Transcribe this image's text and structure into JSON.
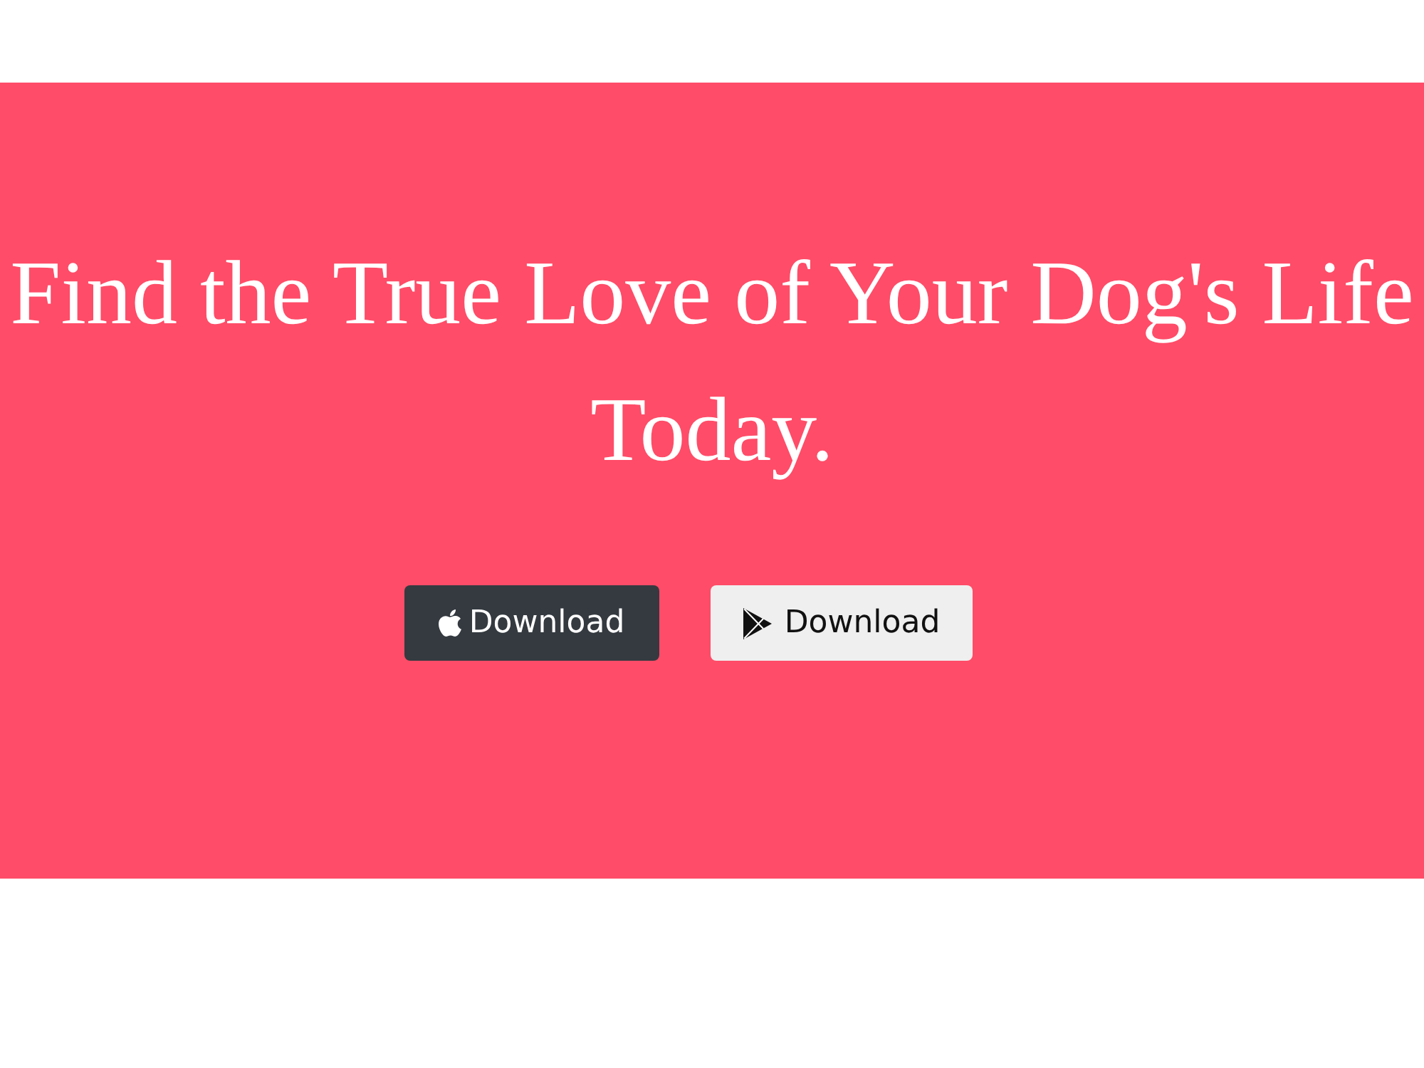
{
  "hero": {
    "title": "Find the True Love of Your Dog's Life Today.",
    "buttons": [
      {
        "kind": "apple",
        "label": "Download"
      },
      {
        "kind": "play",
        "label": "Download"
      }
    ]
  }
}
